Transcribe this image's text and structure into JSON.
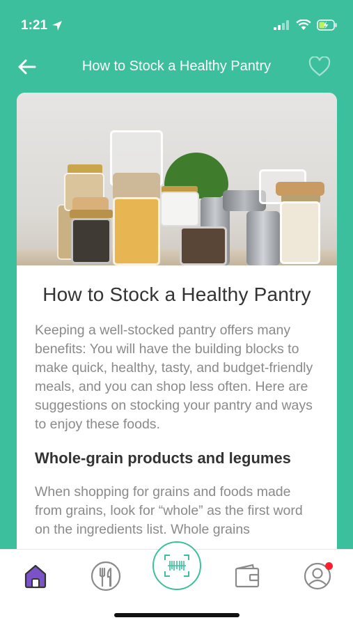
{
  "status": {
    "time": "1:21"
  },
  "nav": {
    "title": "How to Stock a Healthy Pantry"
  },
  "article": {
    "title": "How to Stock a Healthy Pantry",
    "intro": "Keeping a well-stocked pantry offers many benefits: You will have the building blocks to make quick, healthy, tasty, and budget-friendly meals, and you can shop less often. Here are suggestions on stocking your pantry and ways to enjoy these foods.",
    "section_heading": "Whole-grain products and legumes",
    "section_body": "When shopping for grains and foods made from grains, look for “whole” as the first word on the ingredients list. Whole grains"
  },
  "colors": {
    "accent": "#3bbf9c",
    "home_tab": "#7b52c8",
    "notification": "#ff1f2d"
  },
  "tabs": [
    "home-icon",
    "restaurant-icon",
    "barcode-scan-icon",
    "wallet-icon",
    "profile-icon"
  ]
}
